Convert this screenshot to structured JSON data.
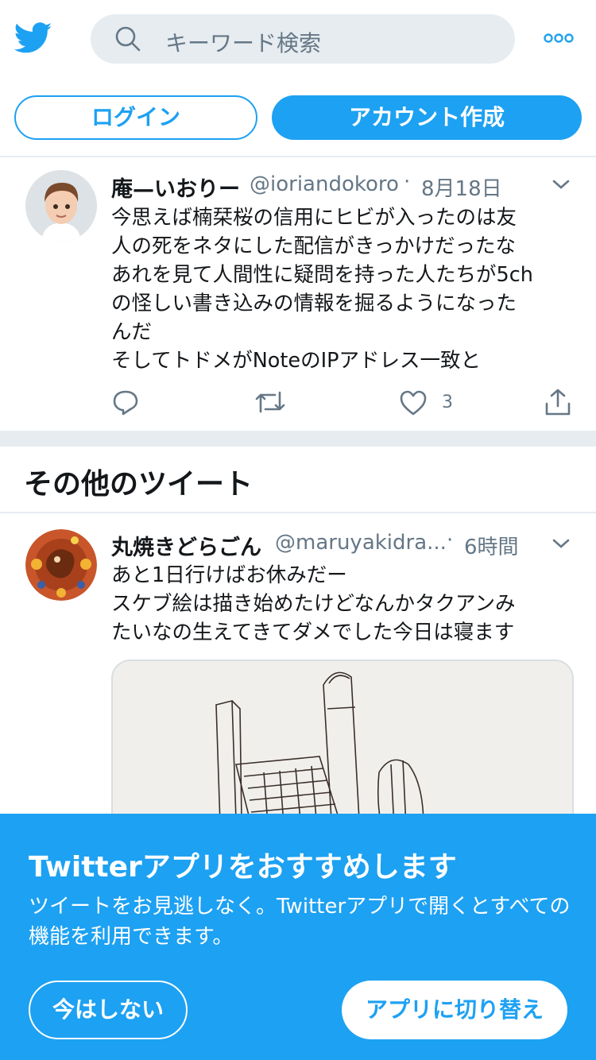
{
  "header": {
    "search_placeholder": "キーワード検索"
  },
  "auth": {
    "login_label": "ログイン",
    "signup_label": "アカウント作成"
  },
  "tweet1": {
    "name": "庵—いおりー",
    "handle": "@ioriandokoro",
    "separator": "·",
    "time": "8月18日",
    "lines": [
      "今思えば楠栞桜の信用にヒビが入ったのは友",
      "人の死をネタにした配信がきっかけだったな",
      "あれを見て人間性に疑問を持った人たちが5ch",
      "の怪しい書き込みの情報を掘るようになった",
      "んだ",
      "そしてトドメがNoteのIPアドレス一致と"
    ],
    "like_count": "3"
  },
  "section": {
    "title": "その他のツイート"
  },
  "tweet2": {
    "name": "丸焼きどらごん",
    "handle": "@maruyakidra...",
    "separator": "·",
    "time": "6時間",
    "lines": [
      "あと1日行けばお休みだー",
      "スケブ絵は描き始めたけどなんかタクアンみ",
      "たいなの生えてきてダメでした今日は寝ます"
    ]
  },
  "banner": {
    "title": "Twitterアプリをおすすめします",
    "text": "ツイートをお見逃しなく。Twitterアプリで開くとすべての機能を利用できます。",
    "not_now_label": "今はしない",
    "switch_label": "アプリに切り替え"
  },
  "colors": {
    "accent": "#1da1f2",
    "text": "#14171a",
    "secondary": "#657786",
    "divider": "#e6ecf0"
  },
  "icons": [
    "twitter-bird-icon",
    "search-icon",
    "more-icon",
    "chevron-down-icon",
    "reply-icon",
    "retweet-icon",
    "like-icon",
    "share-icon"
  ]
}
